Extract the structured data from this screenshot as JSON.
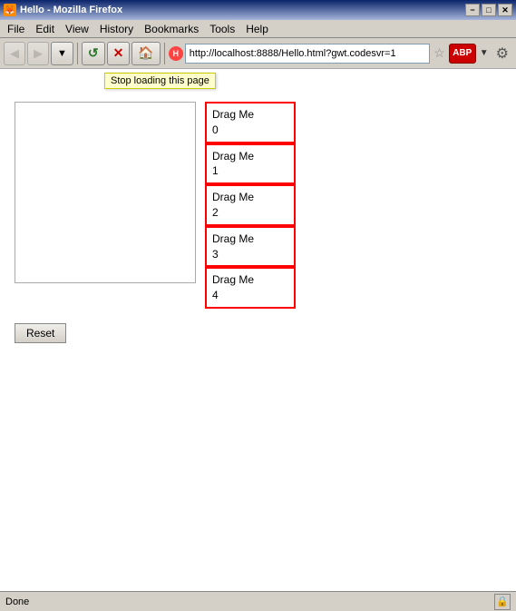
{
  "titleBar": {
    "title": "Hello - Mozilla Firefox",
    "icon": "🦊",
    "minimize": "−",
    "maximize": "□",
    "close": "✕"
  },
  "menuBar": {
    "items": [
      "File",
      "Edit",
      "View",
      "History",
      "Bookmarks",
      "Tools",
      "Help"
    ]
  },
  "navBar": {
    "back": "◀",
    "forward": "▶",
    "dropdown": "▼",
    "reload": "↺",
    "stop": "✕",
    "home": "🏠",
    "url": "http://localhost:8888/Hello.html?gwt.codesvr=1",
    "star": "☆",
    "abp": "ABP",
    "gear": "⚙"
  },
  "tooltip": {
    "text": "Stop loading this page"
  },
  "dragItems": [
    {
      "label": "Drag Me\n0"
    },
    {
      "label": "Drag Me\n1"
    },
    {
      "label": "Drag Me\n2"
    },
    {
      "label": "Drag Me\n3"
    },
    {
      "label": "Drag Me\n4"
    }
  ],
  "resetButton": {
    "label": "Reset"
  },
  "statusBar": {
    "text": "Done"
  }
}
